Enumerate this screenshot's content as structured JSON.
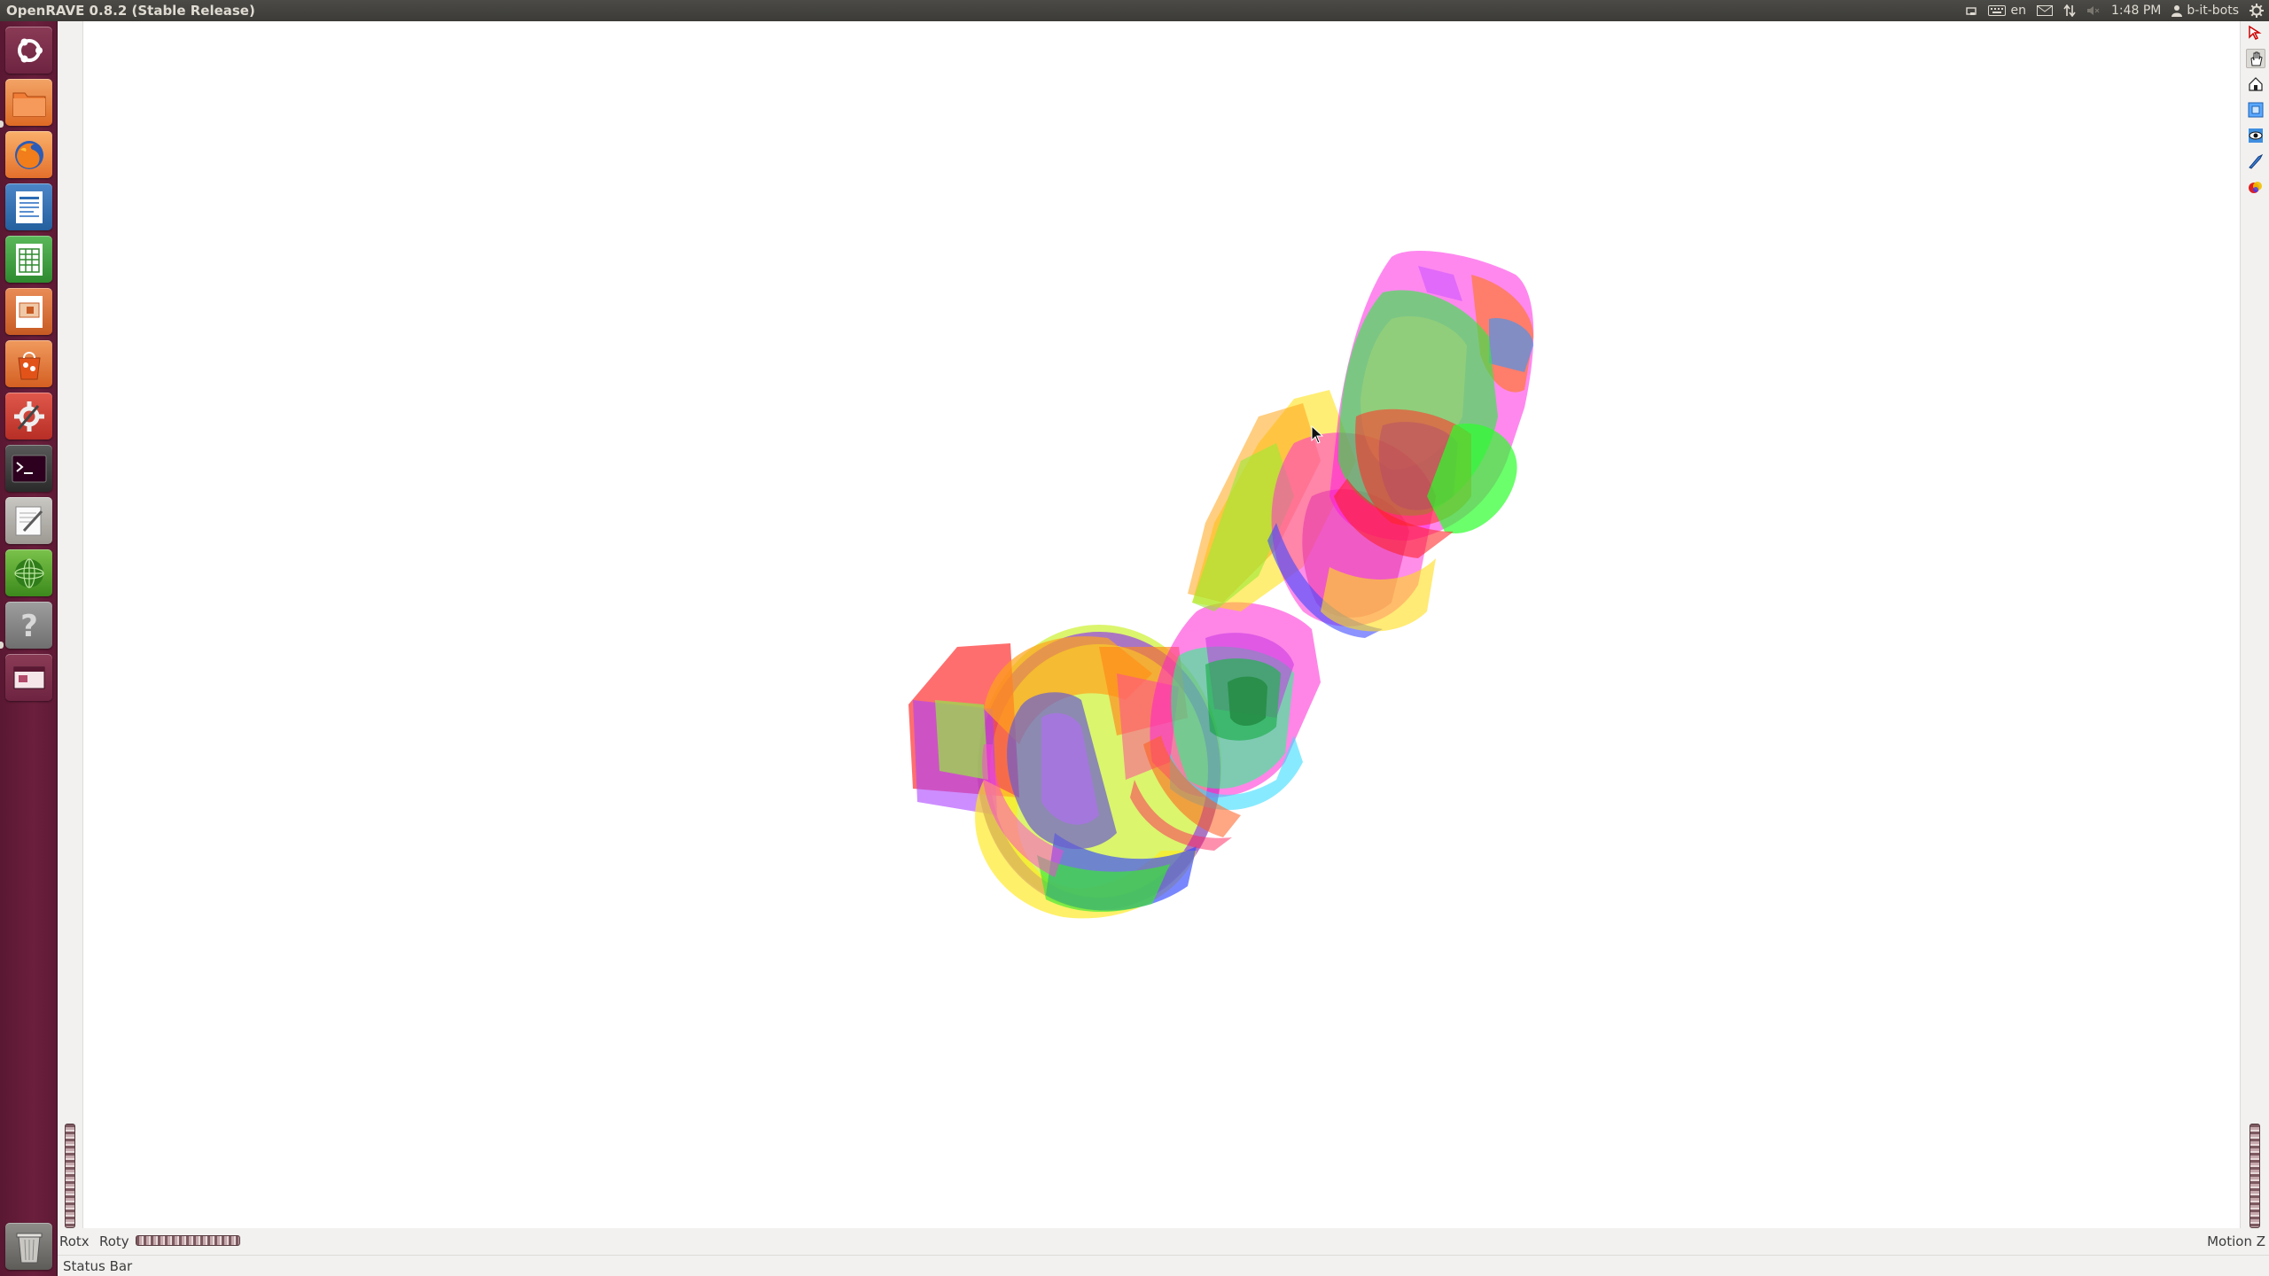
{
  "window": {
    "title": "OpenRAVE 0.8.2 (Stable Release)"
  },
  "top_panel": {
    "keyboard_layout": "en",
    "clock": "1:48 PM",
    "user": "b-it-bots"
  },
  "launcher": {
    "items": [
      {
        "name": "dash-home",
        "icon": "ubuntu-logo"
      },
      {
        "name": "files",
        "icon": "folder-icon"
      },
      {
        "name": "firefox",
        "icon": "firefox-icon"
      },
      {
        "name": "libreoffice-writer",
        "icon": "writer-icon"
      },
      {
        "name": "libreoffice-calc",
        "icon": "calc-icon"
      },
      {
        "name": "libreoffice-impress",
        "icon": "impress-icon"
      },
      {
        "name": "software-center",
        "icon": "shopping-bag-icon"
      },
      {
        "name": "system-settings",
        "icon": "settings-icon"
      },
      {
        "name": "terminal",
        "icon": "terminal-icon"
      },
      {
        "name": "text-editor",
        "icon": "text-editor-icon"
      },
      {
        "name": "workspace-globe",
        "icon": "globe-icon"
      },
      {
        "name": "help",
        "icon": "help-icon"
      },
      {
        "name": "openrave-window",
        "icon": "window-icon"
      },
      {
        "name": "trash",
        "icon": "trash-icon"
      }
    ]
  },
  "viewer": {
    "right_toolbar": [
      "pick-arrow-icon",
      "view-hand-icon",
      "home-icon",
      "view-all-icon",
      "seek-eye-icon",
      "projection-icon",
      "color-palette-icon"
    ]
  },
  "wheels": {
    "rotx_label": "Rotx",
    "roty_label": "Roty",
    "motion_label": "Motion Z"
  },
  "status_bar": {
    "text": "Status Bar"
  }
}
